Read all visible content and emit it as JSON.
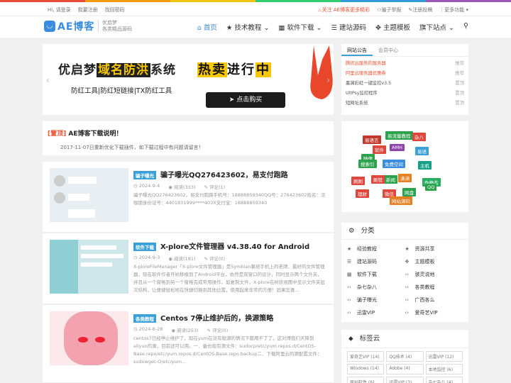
{
  "topbar": {
    "greeting": "Hi, 请登录",
    "register": "我要注册",
    "forgot": "找回密码",
    "follow": "关注 AE博客更多精彩",
    "report": "骗子举报",
    "submit": "注册投稿",
    "more": "更多功能"
  },
  "header": {
    "logo_text": "AE博客",
    "slogan1": "优启梦",
    "slogan2": "各类精品源码",
    "nav": [
      "首页",
      "技术教程",
      "软件下载",
      "建站源码",
      "主题模板",
      "旗下站点"
    ]
  },
  "banner": {
    "title_a": "优启梦",
    "title_b": "域名防洪",
    "title_c": "系统",
    "hot_a": "热卖",
    "hot_b": "进行",
    "hot_c": "中",
    "sub": "防红工具|防红短链接|TX防红工具",
    "button": "点击购买"
  },
  "notice": {
    "tag": "[置顶]",
    "title": "AE博客下载说明！",
    "desc": "2017-11-07日重新优化下载插件，如下载过程中有问题请留言！"
  },
  "posts": [
    {
      "tag": "骗子曝光",
      "title": "骗子曝光QQ276423602，易支付跑路",
      "date": "2024-9-4",
      "views": "阅读(333)",
      "comments": "评论(1)",
      "excerpt": "骗子曝光QQ276423602，易支付跑路手机号：18888859340QQ号：276423602姓名：洁咖朋身份证号：4401831999****403X支付宝：18888859340"
    },
    {
      "tag": "软件下载",
      "title": "X-plore文件管理器 v4.38.40 for Android",
      "date": "2024-9-3",
      "views": "阅读(191)",
      "comments": "评论(0)",
      "excerpt": "X-ploreFileManager「X-plore文件管理器」是Symbian塞班手机上的老牌、最好的文件管理器，现在软件作者开始移植到了Android平台，依然是双窗口的设计，同时显示两个文件夹，并且从一个窗格到另一个窗格完成常用操作，如复制文件，X-plore在树状视图中显示文件夹层次结构，让便捷轻松地在快捷切换到其他位置，使用起来非常的方便！如果您喜..."
    },
    {
      "tag": "各类教程",
      "title": "Centos 7停止维护后的，换源策略",
      "date": "2024-8-28",
      "views": "阅读(253)",
      "comments": "评论(0)",
      "excerpt": "centos7已经停止维护了，现在yum在没有稳源的情况下都用不了了，这对博我们天降到aliyun的源，目前还可以用。一、备份现有源文件：sudocp/etc/yum.repos.d/CentOS-Base.repo/etc/yum.repos.d/CentOS-Base.repo.backup二、下载阿里云的源配置文件：sudowget-O/etc/yum..."
    }
  ],
  "sidebar": {
    "tabs": [
      "网站公告",
      "会员中心"
    ],
    "notices": [
      {
        "title": "腾讯云服务的服务器",
        "date": "推荐"
      },
      {
        "title": "阿里云服务器优惠券",
        "date": "推荐"
      },
      {
        "title": "墨渊彩虹一键监控v3.5",
        "date": "置顶"
      },
      {
        "title": "UltPsy监控程序",
        "date": "置顶"
      },
      {
        "title": "短网址系统",
        "date": "置顶"
      }
    ],
    "cloud": [
      "易流量教程",
      "杂八",
      "易语言",
      "AMH",
      "软件",
      "易语",
      "随便",
      "免费空间",
      "搜索引",
      "主机",
      "刷刷",
      "新闻",
      "伪静态",
      "刷赞",
      "满满",
      "QQ",
      "理财",
      "微信",
      "网盘",
      "网站源码"
    ],
    "cat_title": "分类",
    "categories": [
      "经验教程",
      "资源共享",
      "建站源码",
      "主题模板",
      "软件下载",
      "骇灵说地",
      "杂七杂八",
      "各类教程",
      "骗子曝光",
      "广西各么",
      "迅雷VIP",
      "爱奇艺VIP"
    ],
    "tag_title": "标签云",
    "tags": [
      "爱奇艺VIP (14)",
      "QQ技术 (4)",
      "迅雷VIP (12)",
      "Windows (14)",
      "Adobe (4)",
      "本地监控 (6)",
      "原创软件 (6)",
      "迅雷VIP (3)",
      "杂七杂八 (4)"
    ]
  },
  "colors": {
    "accent": "#3a8ddc",
    "hot": "#e53333",
    "yellow": "#f7c800"
  }
}
